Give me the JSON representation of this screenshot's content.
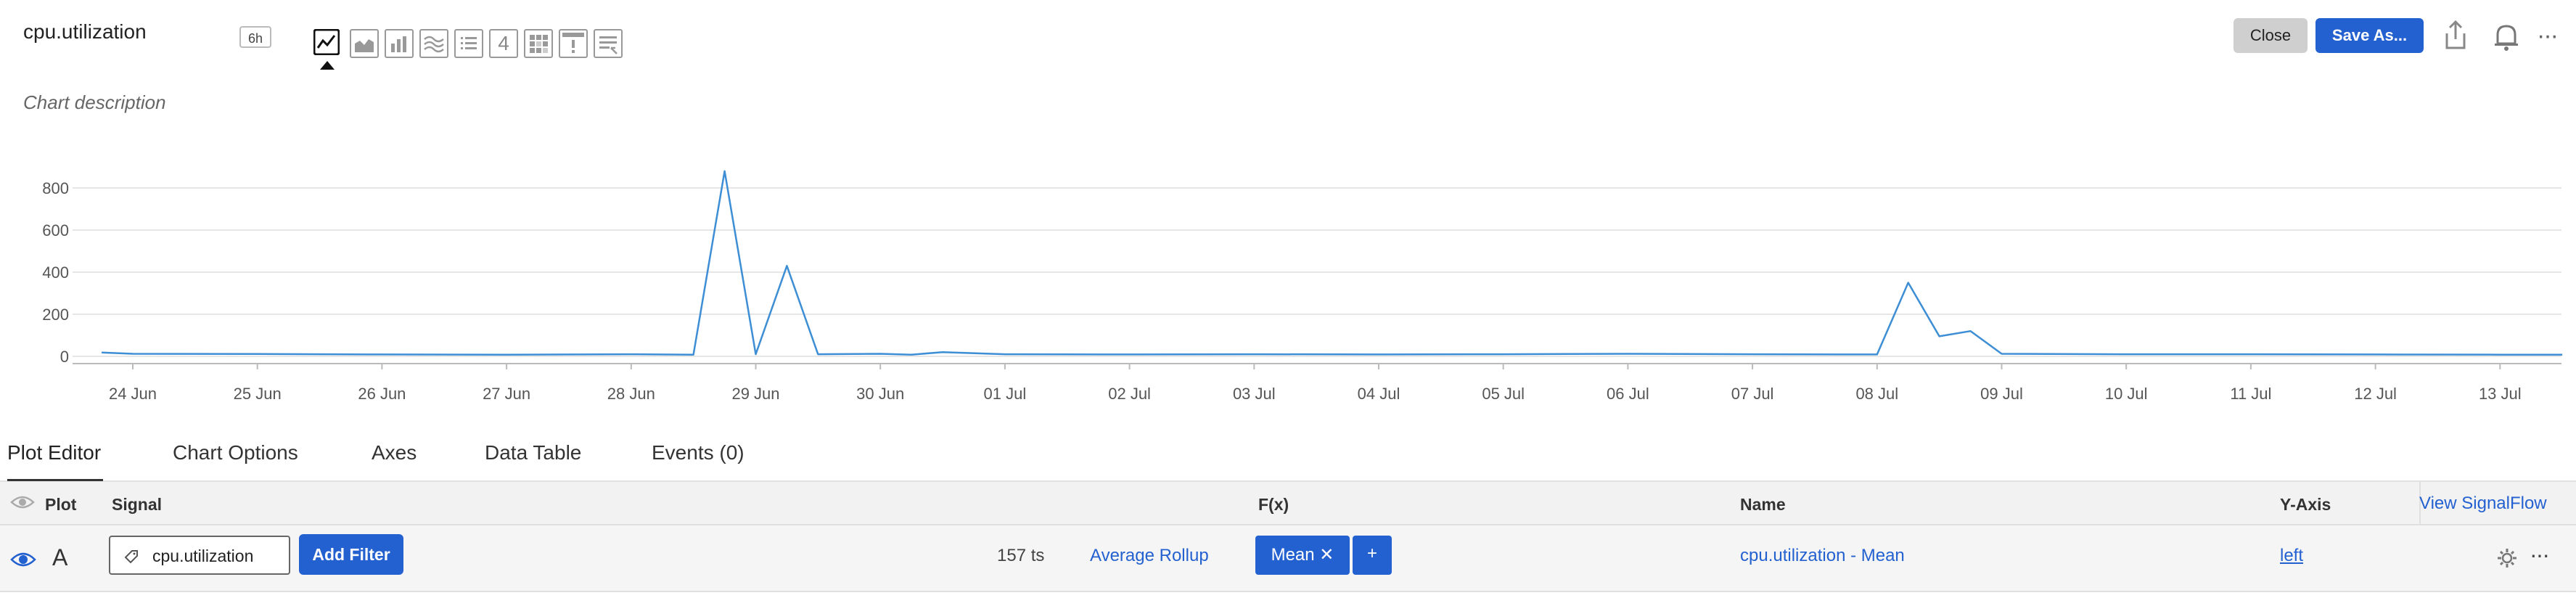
{
  "header": {
    "title": "cpu.utilization",
    "time_range": "6h",
    "description": "Chart description",
    "close_label": "Close",
    "save_as_label": "Save As...",
    "more_label": "···"
  },
  "visualization_types": [
    {
      "name": "line-chart",
      "active": true
    },
    {
      "name": "area-chart",
      "active": false
    },
    {
      "name": "column-chart",
      "active": false
    },
    {
      "name": "histogram",
      "active": false
    },
    {
      "name": "list",
      "active": false
    },
    {
      "name": "single-value",
      "label": "4",
      "active": false
    },
    {
      "name": "heatmap",
      "active": false
    },
    {
      "name": "event-feed",
      "active": false
    },
    {
      "name": "text-note",
      "active": false
    }
  ],
  "colors": {
    "accent": "#2461d0",
    "series": "#3d8ed4",
    "close_bg": "#cfcfcf"
  },
  "chart_data": {
    "type": "line",
    "title": "",
    "xlabel": "",
    "ylabel": "",
    "ylim": [
      0,
      900
    ],
    "y_ticks": [
      "0",
      "200",
      "400",
      "600",
      "800"
    ],
    "x_ticks": [
      "24 Jun",
      "25 Jun",
      "26 Jun",
      "27 Jun",
      "28 Jun",
      "29 Jun",
      "30 Jun",
      "01 Jul",
      "02 Jul",
      "03 Jul",
      "04 Jul",
      "05 Jul",
      "06 Jul",
      "07 Jul",
      "08 Jul",
      "09 Jul",
      "10 Jul",
      "11 Jul",
      "12 Jul",
      "13 Jul"
    ],
    "grid": true,
    "series": [
      {
        "name": "",
        "x": [
          "2024-06-23 18:00",
          "2024-06-24 00:00",
          "2024-06-25 00:00",
          "2024-06-26 00:00",
          "2024-06-27 00:00",
          "2024-06-28 00:00",
          "2024-06-28 12:00",
          "2024-06-28 18:00",
          "2024-06-29 00:00",
          "2024-06-29 06:00",
          "2024-06-29 12:00",
          "2024-06-30 00:00",
          "2024-06-30 06:00",
          "2024-06-30 12:00",
          "2024-07-01 00:00",
          "2024-07-02 00:00",
          "2024-07-03 00:00",
          "2024-07-04 00:00",
          "2024-07-05 00:00",
          "2024-07-06 00:00",
          "2024-07-07 00:00",
          "2024-07-08 00:00",
          "2024-07-08 06:00",
          "2024-07-08 12:00",
          "2024-07-08 18:00",
          "2024-07-09 00:00",
          "2024-07-10 00:00",
          "2024-07-11 00:00",
          "2024-07-12 00:00",
          "2024-07-13 00:00",
          "2024-07-13 12:00"
        ],
        "values": [
          18,
          12,
          11,
          9,
          8,
          10,
          8,
          880,
          10,
          430,
          10,
          12,
          8,
          20,
          10,
          9,
          10,
          9,
          10,
          12,
          10,
          9,
          350,
          95,
          120,
          12,
          10,
          10,
          9,
          8,
          8
        ]
      }
    ]
  },
  "tabs": [
    {
      "label": "Plot Editor"
    },
    {
      "label": "Chart Options"
    },
    {
      "label": "Axes"
    },
    {
      "label": "Data Table"
    },
    {
      "label": "Events (0)"
    }
  ],
  "table": {
    "headers": {
      "plot": "Plot",
      "signal": "Signal",
      "fx": "F(x)",
      "name": "Name",
      "yaxis": "Y-Axis"
    },
    "view_signalflow": "View SignalFlow",
    "rows": [
      {
        "letter": "A",
        "signal": "cpu.utilization",
        "add_filter": "Add Filter",
        "ts_count": "157 ts",
        "rollup": "Average Rollup",
        "fx": "Mean ✕",
        "add_fx": "+",
        "name": "cpu.utilization - Mean",
        "yaxis": "left"
      }
    ]
  }
}
